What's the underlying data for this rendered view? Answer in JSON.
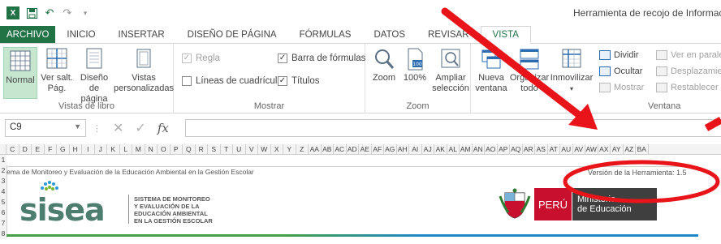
{
  "window": {
    "title": "Herramienta de recojo de Información"
  },
  "quick_access": {
    "app_icon": "excel-icon",
    "save_icon": "save-icon",
    "undo_icon": "undo-icon",
    "redo_icon": "redo-icon",
    "customize_icon": "customize-qat-icon"
  },
  "tabs": [
    {
      "label": "ARCHIVO"
    },
    {
      "label": "INICIO"
    },
    {
      "label": "INSERTAR"
    },
    {
      "label": "DISEÑO DE PÁGINA"
    },
    {
      "label": "FÓRMULAS"
    },
    {
      "label": "DATOS"
    },
    {
      "label": "REVISAR"
    },
    {
      "label": "VISTA"
    }
  ],
  "ribbon": {
    "vistas_de_libro": {
      "label": "Vistas de libro",
      "normal": "Normal",
      "ver_salt_1": "Ver salt.",
      "ver_salt_2": "Pág.",
      "diseno_1": "Diseño",
      "diseno_2": "de página",
      "vistas_1": "Vistas",
      "vistas_2": "personalizadas"
    },
    "mostrar": {
      "label": "Mostrar",
      "regla": "Regla",
      "lineas": "Líneas de cuadrícula",
      "barra": "Barra de fórmulas",
      "titulos": "Títulos",
      "check_mark": "✓"
    },
    "zoom": {
      "label": "Zoom",
      "zoom": "Zoom",
      "cien": "100%",
      "ampliar_1": "Ampliar",
      "ampliar_2": "selección"
    },
    "ventana": {
      "label": "Ventana",
      "nueva_1": "Nueva",
      "nueva_2": "ventana",
      "organizar_1": "Organizar",
      "organizar_2": "todo",
      "inmovilizar": "Inmovilizar",
      "dividir": "Dividir",
      "ocultar": "Ocultar",
      "mostrar": "Mostrar",
      "ver_paralelo": "Ver en paralelo",
      "desplazamiento": "Desplazamien",
      "restablecer": "Restablecer p"
    }
  },
  "formula_bar": {
    "name_box": "C9",
    "fx": "fx",
    "value": ""
  },
  "grid": {
    "columns": [
      "C",
      "D",
      "E",
      "F",
      "G",
      "H",
      "I",
      "J",
      "K",
      "L",
      "M",
      "N",
      "O",
      "P",
      "Q",
      "R",
      "S",
      "T",
      "U",
      "V",
      "W",
      "X",
      "Y",
      "Z",
      "AA",
      "AB",
      "AC",
      "AD",
      "AE",
      "AF",
      "AG",
      "AH",
      "AI",
      "AJ",
      "AK",
      "AL",
      "AM",
      "AN",
      "AO",
      "AP",
      "AQ",
      "AR",
      "AS",
      "AT",
      "AU",
      "AV",
      "AW",
      "AX",
      "AY",
      "AZ",
      "BA"
    ],
    "rows": [
      "1",
      "2",
      "3",
      "4",
      "5",
      "6",
      "7",
      "8"
    ]
  },
  "sheet": {
    "title": "ema de Monitoreo y Evaluación de la Educación Ambiental en la Gestión Escolar",
    "version": "Versión de la Herramienta: 1.5",
    "sisea_word": "sisea",
    "sisea_subtitle": "SISTEMA DE MONITOREO\nY EVALUACIÓN DE LA\nEDUCACIÓN AMBIENTAL\nEN LA GESTIÓN ESCOLAR",
    "peru": "PERÚ",
    "ministerio": "Ministerio\nde Educación"
  },
  "colors": {
    "excel_green": "#217346",
    "annotation_red": "#e8141a",
    "peru_red": "#c8102e",
    "minedu_gray": "#3f3f3f",
    "sisea_green": "#4c7d6e"
  }
}
